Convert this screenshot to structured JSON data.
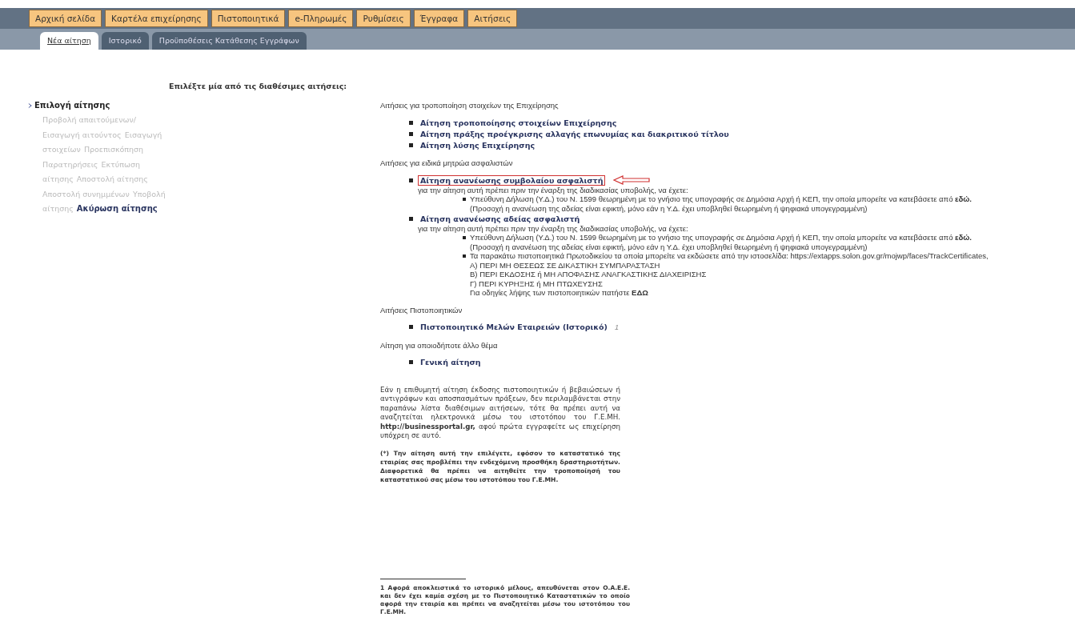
{
  "nav": [
    {
      "label": "Αρχική σελίδα"
    },
    {
      "label": "Καρτέλα επιχείρησης"
    },
    {
      "label": "Πιστοποιητικά"
    },
    {
      "label": "e-Πληρωμές"
    },
    {
      "label": "Ρυθμίσεις"
    },
    {
      "label": "Έγγραφα"
    },
    {
      "label": "Αιτήσεις"
    }
  ],
  "tabs": [
    {
      "label": "Νέα αίτηση",
      "selected": true
    },
    {
      "label": "Ιστορικό",
      "selected": false
    },
    {
      "label": "Προϋποθέσεις Κατάθεσης Εγγράφων",
      "selected": false
    }
  ],
  "heading": "Επιλέξτε μία από τις διαθέσιμες αιτήσεις:",
  "sidebar": {
    "title": "Επιλογή αίτησης",
    "lines": [
      {
        "steps": [
          {
            "label": "Προβολή απαιτούμενων/",
            "disabled": true
          }
        ]
      },
      {
        "steps": [
          {
            "label": "Εισαγωγή αιτούντος",
            "disabled": true
          },
          {
            "label": "Εισαγωγή",
            "disabled": true
          }
        ]
      },
      {
        "steps": [
          {
            "label": "στοιχείων",
            "disabled": true
          },
          {
            "label": "Προεπισκόπηση",
            "disabled": true
          }
        ]
      },
      {
        "steps": [
          {
            "label": "Παρατηρήσεις",
            "disabled": true
          },
          {
            "label": "Εκτύπωση",
            "disabled": true
          }
        ]
      },
      {
        "steps": [
          {
            "label": "αίτησης",
            "disabled": true
          },
          {
            "label": "Αποστολή αίτησης",
            "disabled": true
          }
        ]
      },
      {
        "steps": [
          {
            "label": "Αποστολή συνημμένων",
            "disabled": true
          },
          {
            "label": "Υποβολή",
            "disabled": true
          }
        ]
      },
      {
        "steps": [
          {
            "label": "αίτησης",
            "disabled": true
          },
          {
            "label": "Ακύρωση αίτησης",
            "disabled": false
          }
        ]
      }
    ]
  },
  "sections": [
    {
      "heading": "Αιτήσεις για τροποποίηση στοιχείων της Επιχείρησης",
      "items": [
        {
          "label": "Αίτηση τροποποίησης στοιχείων Επιχείρησης",
          "highlighted": false
        },
        {
          "label": "Αίτηση πράξης προέγκρισης αλλαγής επωνυμίας και διακριτικού τίτλου",
          "highlighted": false
        },
        {
          "label": "Αίτηση λύσης Επιχείρησης",
          "highlighted": false
        }
      ]
    },
    {
      "heading": "Αιτήσεις για ειδικά μητρώα ασφαλιστών",
      "items": [
        {
          "label": "Αίτηση ανανέωσης συμβολαίου ασφαλιστή",
          "highlighted": true,
          "intro": "για την αίτηση αυτή πρέπει πριν την έναρξη της διαδικασίας υποβολής, να έχετε:",
          "requirements": [
            {
              "lines": [
                "Υπεύθυνη Δήλωση (Υ.Δ.) του Ν. 1599 θεωρημένη με το γνήσιο της υπογραφής σε Δημόσια Αρχή ή ΚΕΠ, την οποία μπορείτε να κατεβάσετε από **εδώ.**",
                "(Προσοχή η ανανέωση της αδείας είναι εφικτή, μόνο εάν η Υ.Δ. έχει υποβληθεί θεωρημένη ή ψηφιακά υπογεγραμμένη)"
              ]
            }
          ]
        },
        {
          "label": "Αίτηση ανανέωσης αδείας ασφαλιστή",
          "highlighted": false,
          "intro": "για την αίτηση αυτή πρέπει πριν την έναρξη της διαδικασίας υποβολής, να έχετε:",
          "requirements": [
            {
              "lines": [
                "Υπεύθυνη Δήλωση (Υ.Δ.) του Ν. 1599 θεωρημένη με το γνήσιο της υπογραφής σε Δημόσια Αρχή ή ΚΕΠ, την οποία μπορείτε να κατεβάσετε από **εδώ.**",
                "(Προσοχή η ανανέωση της αδείας είναι εφικτή, μόνο εάν η Υ.Δ. έχει υποβληθεί θεωρημένη ή ψηφιακά υπογεγραμμένη)"
              ]
            },
            {
              "lines": [
                "Τα παρακάτω πιστοποιητικά Πρωτοδικείου τα οποία μπορείτε να εκδώσετε από την ιστοσελίδα: https://extapps.solon.gov.gr/mojwp/faces/TrackCertificates,",
                "Α) ΠΕΡΙ ΜΗ ΘΕΣΕΩΣ ΣΕ ΔΙΚΑΣΤΙΚΗ ΣΥΜΠΑΡΑΣΤΑΣΗ",
                "Β) ΠΕΡΙ ΕΚΔΟΣΗΣ ή ΜΗ ΑΠΟΦΑΣΗΣ ΑΝΑΓΚΑΣΤΙΚΗΣ ΔΙΑΧΕΙΡΙΣΗΣ",
                "Γ) ΠΕΡΙ ΚΥΡΗΞΗΣ ή ΜΗ ΠΤΩΧΕΥΣΗΣ",
                "Για οδηγίες λήψης των πιστοποιητικών πατήστε **ΕΔΩ**"
              ]
            }
          ]
        }
      ]
    },
    {
      "heading": "Αιτήσεις Πιστοποιητικών",
      "items": [
        {
          "label": "Πιστοποιητικό Μελών Εταιρειών (Ιστορικό)",
          "highlighted": false,
          "footnote_mark": "1"
        }
      ]
    },
    {
      "heading": "Αίτηση για οποιοδήποτε άλλο θέμα",
      "items": [
        {
          "label": "Γενική αίτηση",
          "highlighted": false
        }
      ]
    }
  ],
  "info": "Εάν η επιθυμητή αίτηση έκδοσης πιστοποιητικών ή βεβαιώσεων ή αντιγράφων και αποσπασμάτων πράξεων, δεν περιλαμβάνεται στην παραπάνω λίστα διαθέσιμων αιτήσεων, τότε θα πρέπει αυτή να αναζητείται ηλεκτρονικά μέσω του ιστοτόπου του Γ.Ε.ΜΗ. **http://businessportal.gr,** αφού πρώτα εγγραφείτε ως επιχείρηση υπόχρεη σε αυτό.",
  "note": "(*) Την αίτηση αυτή την επιλέγετε, εφόσον το καταστατικό της εταιρίας σας προβλέπει την ενδεχόμενη προσθήκη δραστηριοτήτων. Διαφορετικά θα πρέπει να αιτηθείτε την τροποποίησή του καταστατικού σας μέσω του ιστοτόπου του Γ.Ε.ΜΗ.",
  "footnote": "1 Αφορά αποκλειστικά το ιστορικό μέλους, απευθύνεται στον Ο.Α.Ε.Ε. και δεν έχει καμία σχέση με το Πιστοποιητικό Καταστατικών το οποίο αφορά την εταιρία και πρέπει να αναζητείται μέσω του ιστοτόπου του Γ.Ε.ΜΗ."
}
